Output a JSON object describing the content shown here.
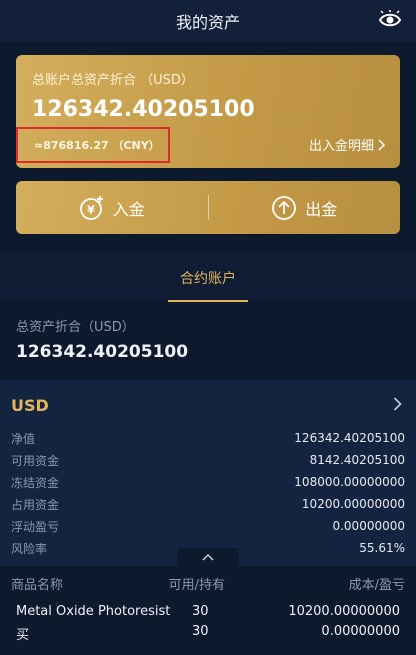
{
  "header": {
    "title": "我的资产",
    "icon": "eye-icon"
  },
  "asset_card": {
    "label": "总账户总资产折合 （USD）",
    "amount": "126342.40205100",
    "cny_equiv": "≈876816.27 （CNY）",
    "detail_link": "出入金明细"
  },
  "actions": {
    "deposit": "入金",
    "withdraw": "出金"
  },
  "tabs": [
    {
      "label": "合约账户",
      "active": true
    }
  ],
  "summary": {
    "label": "总资产折合（USD）",
    "value": "126342.40205100"
  },
  "usd_account": {
    "currency": "USD",
    "rows": [
      {
        "label": "净值",
        "value": "126342.40205100"
      },
      {
        "label": "可用资金",
        "value": "8142.40205100"
      },
      {
        "label": "冻结资金",
        "value": "108000.00000000"
      },
      {
        "label": "占用资金",
        "value": "10200.00000000"
      },
      {
        "label": "浮动盈亏",
        "value": "0.00000000"
      },
      {
        "label": "风险率",
        "value": "55.61%"
      }
    ]
  },
  "holdings": {
    "headers": {
      "name": "商品名称",
      "qty": "可用/持有",
      "cost": "成本/盈亏"
    },
    "rows": [
      {
        "name": "Metal Oxide Photoresist",
        "qty": "30",
        "cost": "10200.00000000"
      },
      {
        "name": "买",
        "qty": "30",
        "cost": "0.00000000"
      }
    ]
  },
  "colors": {
    "accent": "#e2b35a",
    "card_gold": "#c49a47",
    "background": "#0d1a2e",
    "highlight_box": "#e02b2b"
  }
}
